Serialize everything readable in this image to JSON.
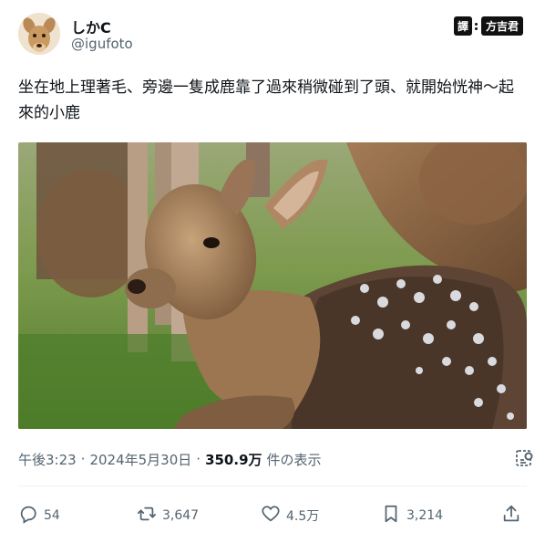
{
  "author": {
    "display_name": "しかC",
    "handle": "@igufoto"
  },
  "translator_badge": {
    "label": "譯",
    "name": "方吉君"
  },
  "tweet": {
    "text": "坐在地上理著毛、旁邊一隻成鹿靠了過來稍微碰到了頭、就開始恍神～起來的小鹿"
  },
  "meta": {
    "time": "午後3:23",
    "separator": "·",
    "date": "2024年5月30日",
    "views_count": "350.9万",
    "views_label": "件の表示"
  },
  "actions": {
    "replies": "54",
    "retweets": "3,647",
    "likes": "4.5万",
    "bookmarks": "3,214"
  },
  "icons": {
    "reply": "reply-icon",
    "retweet": "retweet-icon",
    "like": "heart-icon",
    "bookmark": "bookmark-icon",
    "share": "share-icon",
    "analytics": "analytics-icon"
  },
  "colors": {
    "text": "#0f1419",
    "secondary": "#536471",
    "divider": "#eff3f4"
  }
}
